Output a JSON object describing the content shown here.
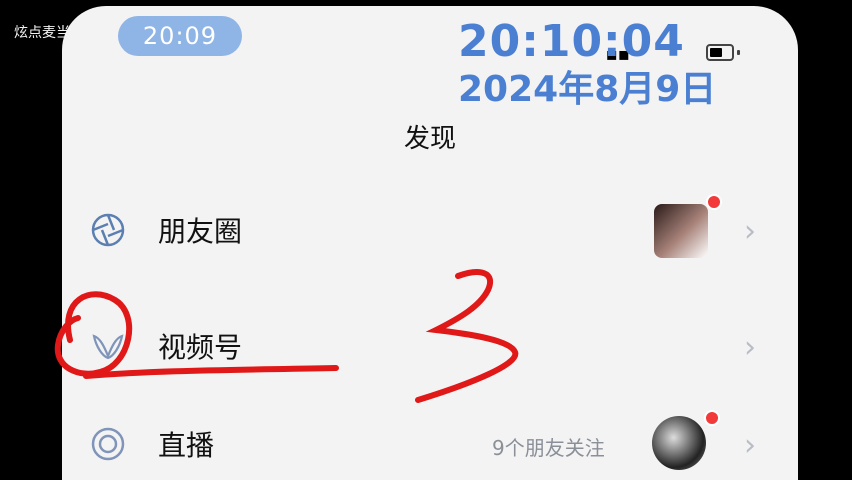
{
  "watermark": "炫点麦当",
  "status_bar": {
    "time": "20:09"
  },
  "overlay": {
    "time": "20:10:04",
    "date": "2024年8月9日"
  },
  "header": {
    "title": "发现"
  },
  "rows": [
    {
      "label": "朋友圈",
      "icon": "moments-icon",
      "has_avatar": true,
      "badge": "red-dot"
    },
    {
      "label": "视频号",
      "icon": "channels-icon"
    },
    {
      "label": "直播",
      "icon": "live-icon",
      "extra": "9个朋友关注",
      "has_avatar": true,
      "badge": "red-dot"
    }
  ],
  "annotation": {
    "number_drawn": "3",
    "color": "#e01818"
  },
  "colors": {
    "accent": "#4a7fd1",
    "badge": "#f23a3a",
    "pill": "#8fb4e6"
  }
}
